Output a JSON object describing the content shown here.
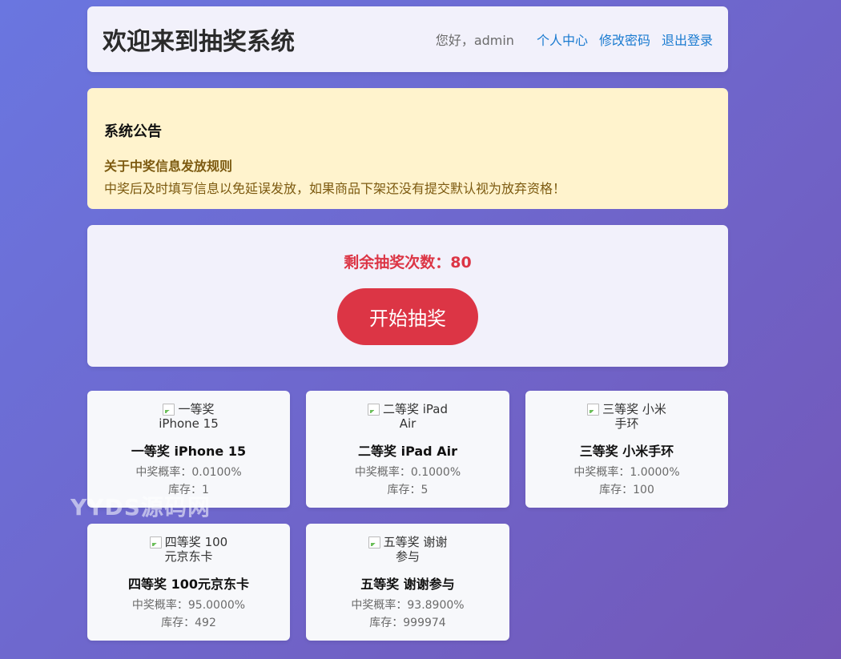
{
  "header": {
    "title": "欢迎来到抽奖系统",
    "greeting": "您好，admin",
    "links": [
      "个人中心",
      "修改密码",
      "退出登录"
    ]
  },
  "announcement": {
    "heading": "系统公告",
    "subtitle": "关于中奖信息发放规则",
    "text": "中奖后及时填写信息以免延误发放，如果商品下架还没有提交默认视为放弃资格！"
  },
  "draw": {
    "remaining": "剩余抽奖次数：80",
    "button_label": "开始抽奖"
  },
  "prizes": [
    {
      "alt": "一等奖 iPhone 15",
      "name": "一等奖 iPhone 15",
      "prob": "中奖概率：0.0100%",
      "stock": "库存：1"
    },
    {
      "alt": "二等奖 iPad Air",
      "name": "二等奖 iPad Air",
      "prob": "中奖概率：0.1000%",
      "stock": "库存：5"
    },
    {
      "alt": "三等奖 小米手环",
      "name": "三等奖 小米手环",
      "prob": "中奖概率：1.0000%",
      "stock": "库存：100"
    },
    {
      "alt": "四等奖 100元京东卡",
      "name": "四等奖 100元京东卡",
      "prob": "中奖概率：95.0000%",
      "stock": "库存：492"
    },
    {
      "alt": "五等奖 谢谢参与",
      "name": "五等奖 谢谢参与",
      "prob": "中奖概率：93.8900%",
      "stock": "库存：999974"
    }
  ],
  "watermark": "YYDS源码网",
  "colors": {
    "accent": "#dc3545",
    "link": "#1a7bd0",
    "announcement_bg": "#fff3cd"
  }
}
